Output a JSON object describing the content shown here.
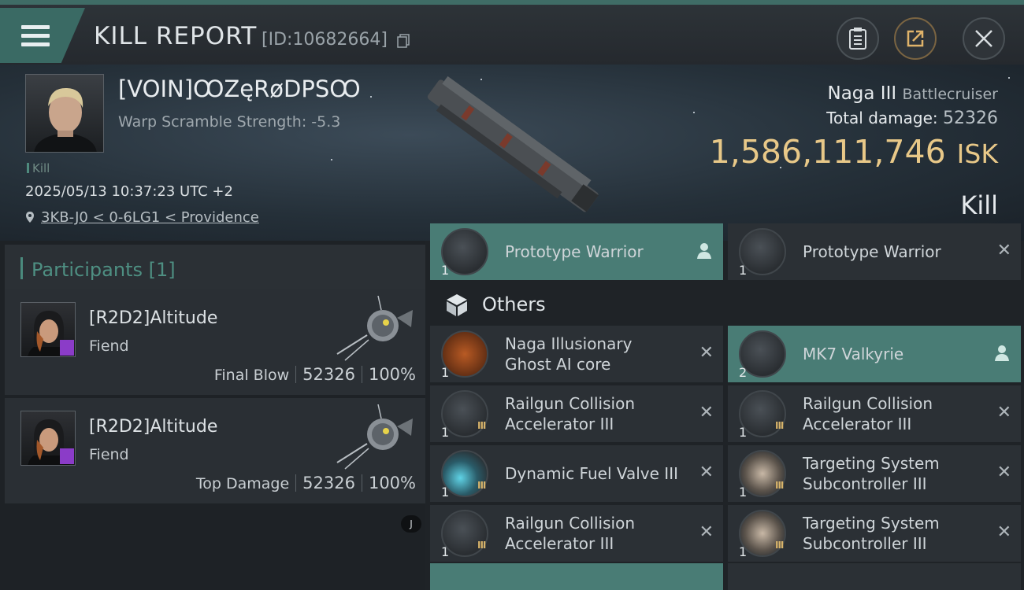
{
  "header": {
    "title": "KILL REPORT",
    "report_id": "[ID:10682664]",
    "menu_icon": "hamburger-icon",
    "buttons": [
      {
        "name": "clipboard-button",
        "icon": "clipboard-icon"
      },
      {
        "name": "share-button",
        "icon": "share-icon"
      },
      {
        "name": "close-button",
        "icon": "close-icon"
      }
    ]
  },
  "victim": {
    "name": "[VOIN]ꝎZęRøDPSꝎ",
    "warp_scramble": "Warp Scramble Strength: -5.3",
    "kill_tag": "Kill",
    "datetime": "2025/05/13 10:37:23 UTC +2",
    "location": "3KB-J0 < 0-6LG1 < Providence",
    "ship": "Naga III",
    "ship_class": "Battlecruiser",
    "total_damage_label": "Total damage:",
    "total_damage": "52326",
    "isk_value": "1,586,111,746",
    "isk_unit": "ISK",
    "result": "Kill"
  },
  "participants": {
    "title": "Participants",
    "count": "[1]",
    "cards": [
      {
        "name": "[R2D2]Altitude",
        "ship": "Fiend",
        "role": "Final Blow",
        "damage": "52326",
        "percent": "100%"
      },
      {
        "name": "[R2D2]Altitude",
        "ship": "Fiend",
        "role": "Top Damage",
        "damage": "52326",
        "percent": "100%"
      }
    ],
    "j_button": "J"
  },
  "items": {
    "top_row": [
      {
        "name": "Prototype  Warrior",
        "qty": "1",
        "highlighted": true
      },
      {
        "name": "Prototype  Warrior",
        "qty": "1",
        "highlighted": false
      }
    ],
    "others_label": "Others",
    "rows": [
      [
        {
          "name": "Naga Illusionary Ghost AI core",
          "line1": "Naga Illusionary",
          "line2": "Ghost AI core",
          "qty": "1"
        },
        {
          "name": "MK7  Valkyrie",
          "line1": "MK7  Valkyrie",
          "line2": "",
          "qty": "2"
        }
      ],
      [
        {
          "name": "Railgun Collision Accelerator III",
          "line1": "Railgun Collision",
          "line2": "Accelerator III",
          "qty": "1",
          "tier": "III"
        },
        {
          "name": "Railgun Collision Accelerator III",
          "line1": "Railgun Collision",
          "line2": "Accelerator III",
          "qty": "1",
          "tier": "III"
        }
      ],
      [
        {
          "name": "Dynamic Fuel Valve III",
          "line1": "Dynamic Fuel Valve III",
          "line2": "",
          "qty": "1",
          "tier": "III"
        },
        {
          "name": "Targeting System Subcontroller III",
          "line1": "Targeting System",
          "line2": "Subcontroller III",
          "qty": "1",
          "tier": "III"
        }
      ],
      [
        {
          "name": "Railgun Collision Accelerator III",
          "line1": "Railgun Collision",
          "line2": "Accelerator III",
          "qty": "1",
          "tier": "III"
        },
        {
          "name": "Targeting System Subcontroller III",
          "line1": "Targeting System",
          "line2": "Subcontroller III",
          "qty": "1",
          "tier": "III"
        }
      ]
    ],
    "remove_glyph": "✕"
  },
  "colors": {
    "accent": "#4e8f82",
    "highlight_row": "#497c75",
    "isk": "#e8c888",
    "badge": "#8b3cc8"
  }
}
